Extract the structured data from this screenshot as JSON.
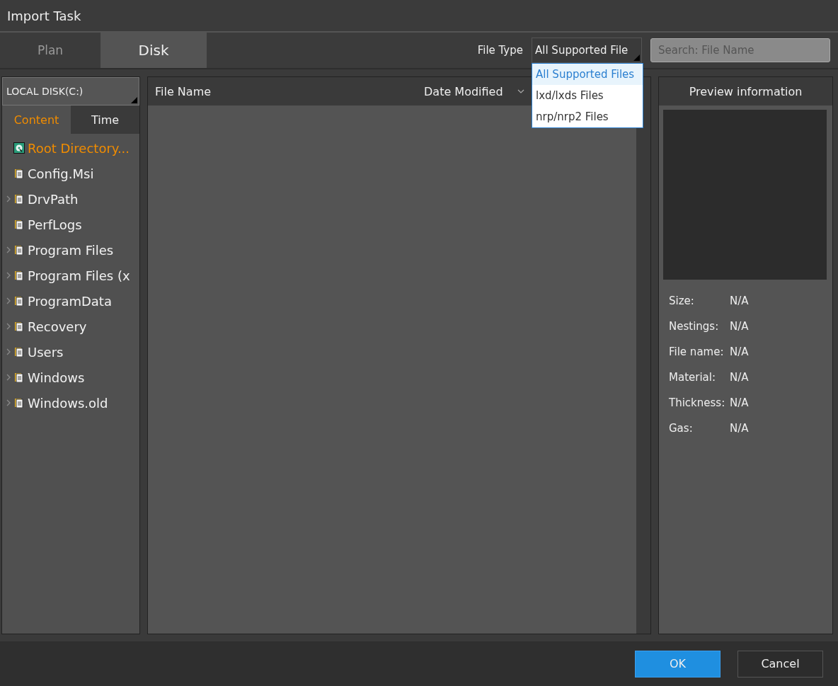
{
  "window": {
    "title": "Import Task"
  },
  "tabs": [
    {
      "label": "Plan",
      "selected": false
    },
    {
      "label": "Disk",
      "selected": true
    }
  ],
  "file_type": {
    "label": "File Type",
    "value": "All Supported File",
    "options": [
      {
        "label": "All Supported Files",
        "selected": true
      },
      {
        "label": "lxd/lxds Files",
        "selected": false
      },
      {
        "label": "nrp/nrp2 Files",
        "selected": false
      }
    ]
  },
  "search": {
    "placeholder": "Search: File Name"
  },
  "drive": {
    "value": "LOCAL DISK(C:)"
  },
  "sidebar_tabs": [
    {
      "label": "Content",
      "selected": true
    },
    {
      "label": "Time",
      "selected": false
    }
  ],
  "tree": [
    {
      "label": "Root Directory...",
      "kind": "drive",
      "selected": true,
      "expandable": false
    },
    {
      "label": "Config.Msi",
      "kind": "folder",
      "selected": false,
      "expandable": false
    },
    {
      "label": "DrvPath",
      "kind": "folder",
      "selected": false,
      "expandable": true
    },
    {
      "label": "PerfLogs",
      "kind": "folder",
      "selected": false,
      "expandable": false
    },
    {
      "label": "Program Files",
      "kind": "folder",
      "selected": false,
      "expandable": true
    },
    {
      "label": "Program Files (x",
      "kind": "folder",
      "selected": false,
      "expandable": true
    },
    {
      "label": "ProgramData",
      "kind": "folder",
      "selected": false,
      "expandable": true
    },
    {
      "label": "Recovery",
      "kind": "folder",
      "selected": false,
      "expandable": true
    },
    {
      "label": "Users",
      "kind": "folder",
      "selected": false,
      "expandable": true
    },
    {
      "label": "Windows",
      "kind": "folder",
      "selected": false,
      "expandable": true
    },
    {
      "label": "Windows.old",
      "kind": "folder",
      "selected": false,
      "expandable": true
    }
  ],
  "table": {
    "columns": [
      "File Name",
      "Date Modified"
    ]
  },
  "preview": {
    "title": "Preview information",
    "fields": [
      {
        "label": "Size:",
        "value": "N/A"
      },
      {
        "label": "Nestings:",
        "value": "N/A"
      },
      {
        "label": "File name:",
        "value": "N/A"
      },
      {
        "label": "Material:",
        "value": "N/A"
      },
      {
        "label": "Thickness:",
        "value": "N/A"
      },
      {
        "label": "Gas:",
        "value": "N/A"
      }
    ]
  },
  "buttons": [
    {
      "label": "OK",
      "kind": "primary"
    },
    {
      "label": "Cancel",
      "kind": "secondary"
    }
  ]
}
